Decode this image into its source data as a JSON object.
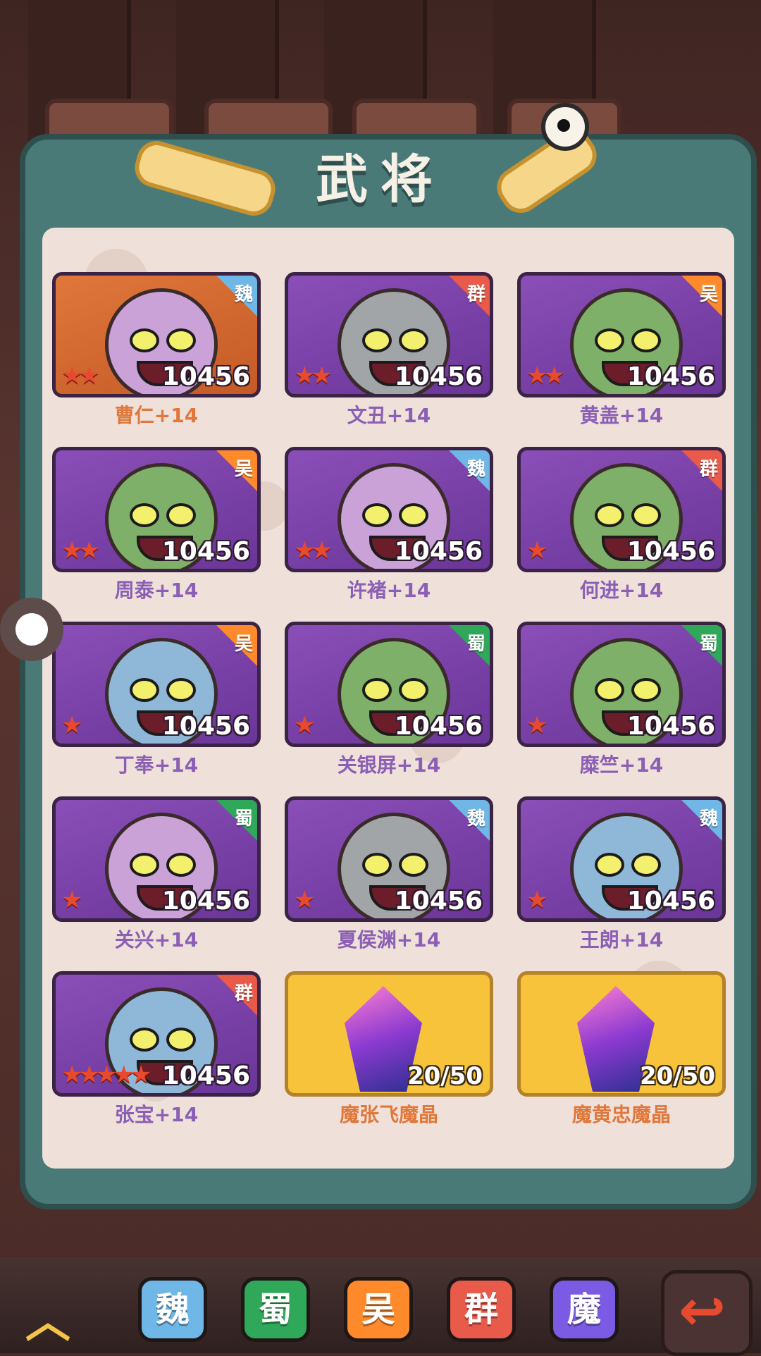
{
  "title": "武将",
  "colors": {
    "wei": "#6fb7e6",
    "shu": "#2fa85a",
    "wu": "#ff8a2c",
    "qun": "#e85a4a",
    "mo": "#7b5be3"
  },
  "cards": [
    {
      "name": "曹仁+14",
      "faction": "魏",
      "power": "10456",
      "stars": "★★",
      "style": "orange",
      "face": "pinkish"
    },
    {
      "name": "文丑+14",
      "faction": "群",
      "power": "10456",
      "stars": "★★",
      "style": "purple",
      "face": "gray"
    },
    {
      "name": "黄盖+14",
      "faction": "吴",
      "power": "10456",
      "stars": "★★",
      "style": "purple",
      "face": "green"
    },
    {
      "name": "周泰+14",
      "faction": "吴",
      "power": "10456",
      "stars": "★★",
      "style": "purple",
      "face": "green"
    },
    {
      "name": "许褚+14",
      "faction": "魏",
      "power": "10456",
      "stars": "★★",
      "style": "purple",
      "face": "pinkish"
    },
    {
      "name": "何进+14",
      "faction": "群",
      "power": "10456",
      "stars": "★",
      "style": "purple",
      "face": "green"
    },
    {
      "name": "丁奉+14",
      "faction": "吴",
      "power": "10456",
      "stars": "★",
      "style": "purple",
      "face": "blue"
    },
    {
      "name": "关银屏+14",
      "faction": "蜀",
      "power": "10456",
      "stars": "★",
      "style": "purple",
      "face": "green"
    },
    {
      "name": "糜竺+14",
      "faction": "蜀",
      "power": "10456",
      "stars": "★",
      "style": "purple",
      "face": "green"
    },
    {
      "name": "关兴+14",
      "faction": "蜀",
      "power": "10456",
      "stars": "★",
      "style": "purple",
      "face": "pinkish"
    },
    {
      "name": "夏侯渊+14",
      "faction": "魏",
      "power": "10456",
      "stars": "★",
      "style": "purple",
      "face": "gray"
    },
    {
      "name": "王朗+14",
      "faction": "魏",
      "power": "10456",
      "stars": "★",
      "style": "purple",
      "face": "blue"
    },
    {
      "name": "张宝+14",
      "faction": "群",
      "power": "10456",
      "stars": "★★★★★",
      "style": "purple",
      "face": "blue"
    },
    {
      "name": "魔张飞魔晶",
      "faction": "",
      "power": "",
      "stars": "",
      "style": "gold",
      "fragments": "20/50"
    },
    {
      "name": "魔黄忠魔晶",
      "faction": "",
      "power": "",
      "stars": "",
      "style": "gold",
      "fragments": "20/50"
    }
  ],
  "factions": [
    {
      "label": "魏",
      "key": "wei"
    },
    {
      "label": "蜀",
      "key": "shu"
    },
    {
      "label": "吴",
      "key": "wu"
    },
    {
      "label": "群",
      "key": "qun"
    },
    {
      "label": "魔",
      "key": "mo"
    }
  ],
  "icons": {
    "up": "chevron-up-icon",
    "back": "return-arrow-icon",
    "handle": "floating-dot-icon"
  }
}
